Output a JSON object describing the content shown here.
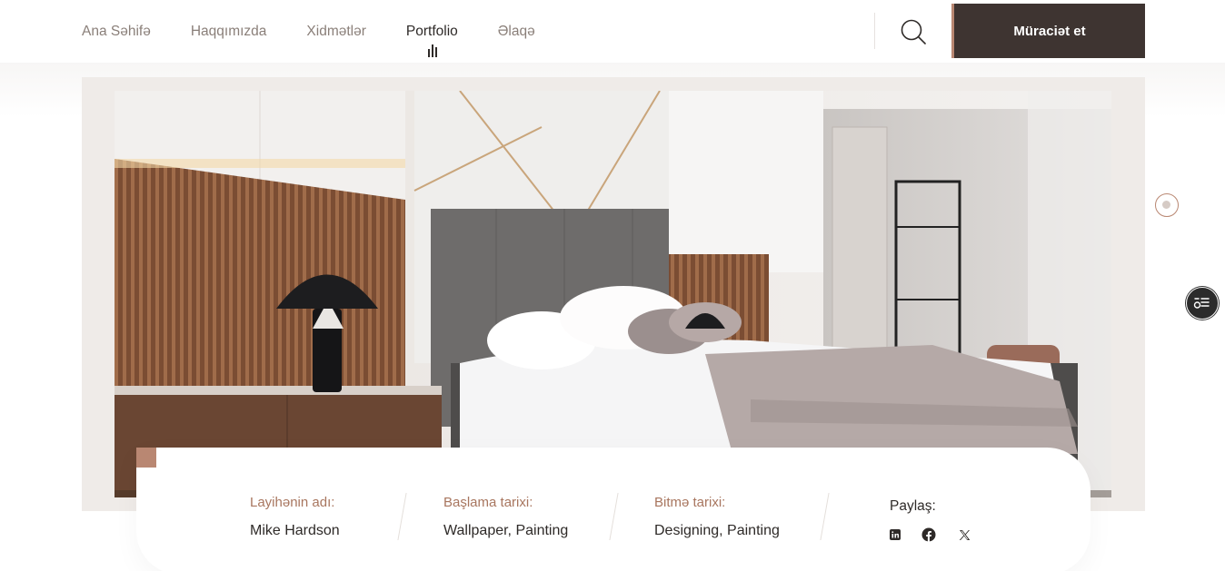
{
  "nav": {
    "items": [
      {
        "label": "Ana Səhifə"
      },
      {
        "label": "Haqqımızda"
      },
      {
        "label": "Xidmətlər"
      },
      {
        "label": "Portfolio"
      },
      {
        "label": "Əlaqə"
      }
    ],
    "active": "Portfolio"
  },
  "header": {
    "cta_label": "Müraciət et",
    "search_icon": "search-icon"
  },
  "project": {
    "name_label": "Layihənin adı:",
    "name_value": "Mike Hardson",
    "start_label": "Başlama tarixi:",
    "start_value": "Wallpaper, Painting",
    "end_label": "Bitmə tarixi:",
    "end_value": "Designing, Painting",
    "share_label": "Paylaş:",
    "social": [
      "linkedin-icon",
      "facebook-icon",
      "x-icon"
    ]
  },
  "colors": {
    "accent": "#b98772",
    "dark": "#3e3431",
    "label": "#a8765f"
  }
}
